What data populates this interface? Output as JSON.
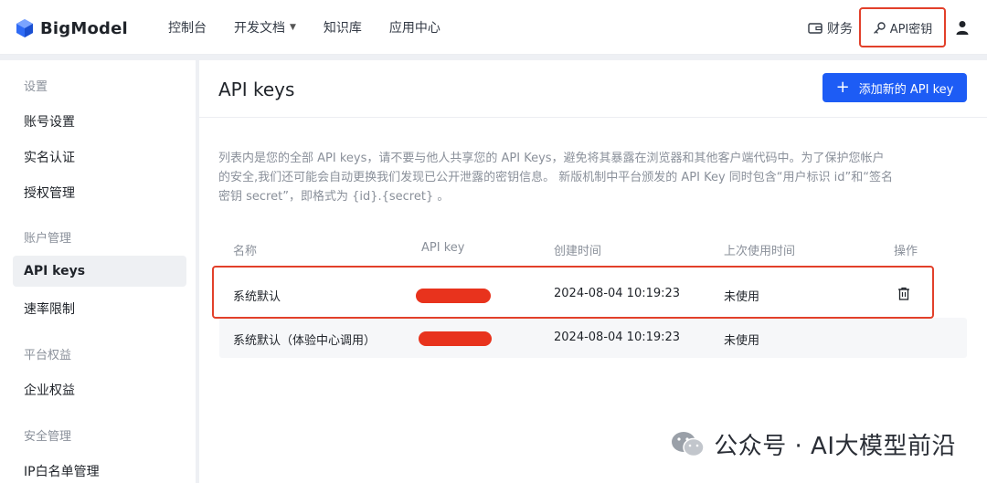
{
  "header": {
    "logo_text": "BigModel",
    "nav": [
      {
        "label": "控制台"
      },
      {
        "label": "开发文档"
      },
      {
        "label": "知识库"
      },
      {
        "label": "应用中心"
      }
    ],
    "billing_label": "财务",
    "api_key_label": "API密钥"
  },
  "sidebar": {
    "groups": [
      {
        "title": "设置",
        "items": [
          "账号设置",
          "实名认证",
          "授权管理"
        ]
      },
      {
        "title": "账户管理",
        "items": [
          "API keys",
          "速率限制"
        ]
      },
      {
        "title": "平台权益",
        "items": [
          "企业权益"
        ]
      },
      {
        "title": "安全管理",
        "items": [
          "IP白名单管理"
        ]
      }
    ],
    "active_item": "API keys"
  },
  "main": {
    "title": "API keys",
    "add_button_label": "添加新的 API key",
    "description": "列表内是您的全部 API keys，请不要与他人共享您的 API Keys，避免将其暴露在浏览器和其他客户端代码中。为了保护您帐户的安全,我们还可能会自动更换我们发现已公开泄露的密钥信息。 新版机制中平台颁发的 API Key 同时包含“用户标识 id”和“签名密钥 secret”，即格式为 {id}.{secret} 。",
    "table": {
      "headers": [
        "名称",
        "API key",
        "创建时间",
        "上次使用时间",
        "操作"
      ],
      "rows": [
        {
          "name": "系统默认",
          "created": "2024-08-04 10:19:23",
          "last_used": "未使用"
        },
        {
          "name": "系统默认（体验中心调用）",
          "created": "2024-08-04 10:19:23",
          "last_used": "未使用"
        }
      ]
    }
  },
  "watermark": "公众号 · AI大模型前沿",
  "colors": {
    "accent": "#1d5cf5",
    "highlight": "#e2402a",
    "redaction": "#e8331d"
  }
}
